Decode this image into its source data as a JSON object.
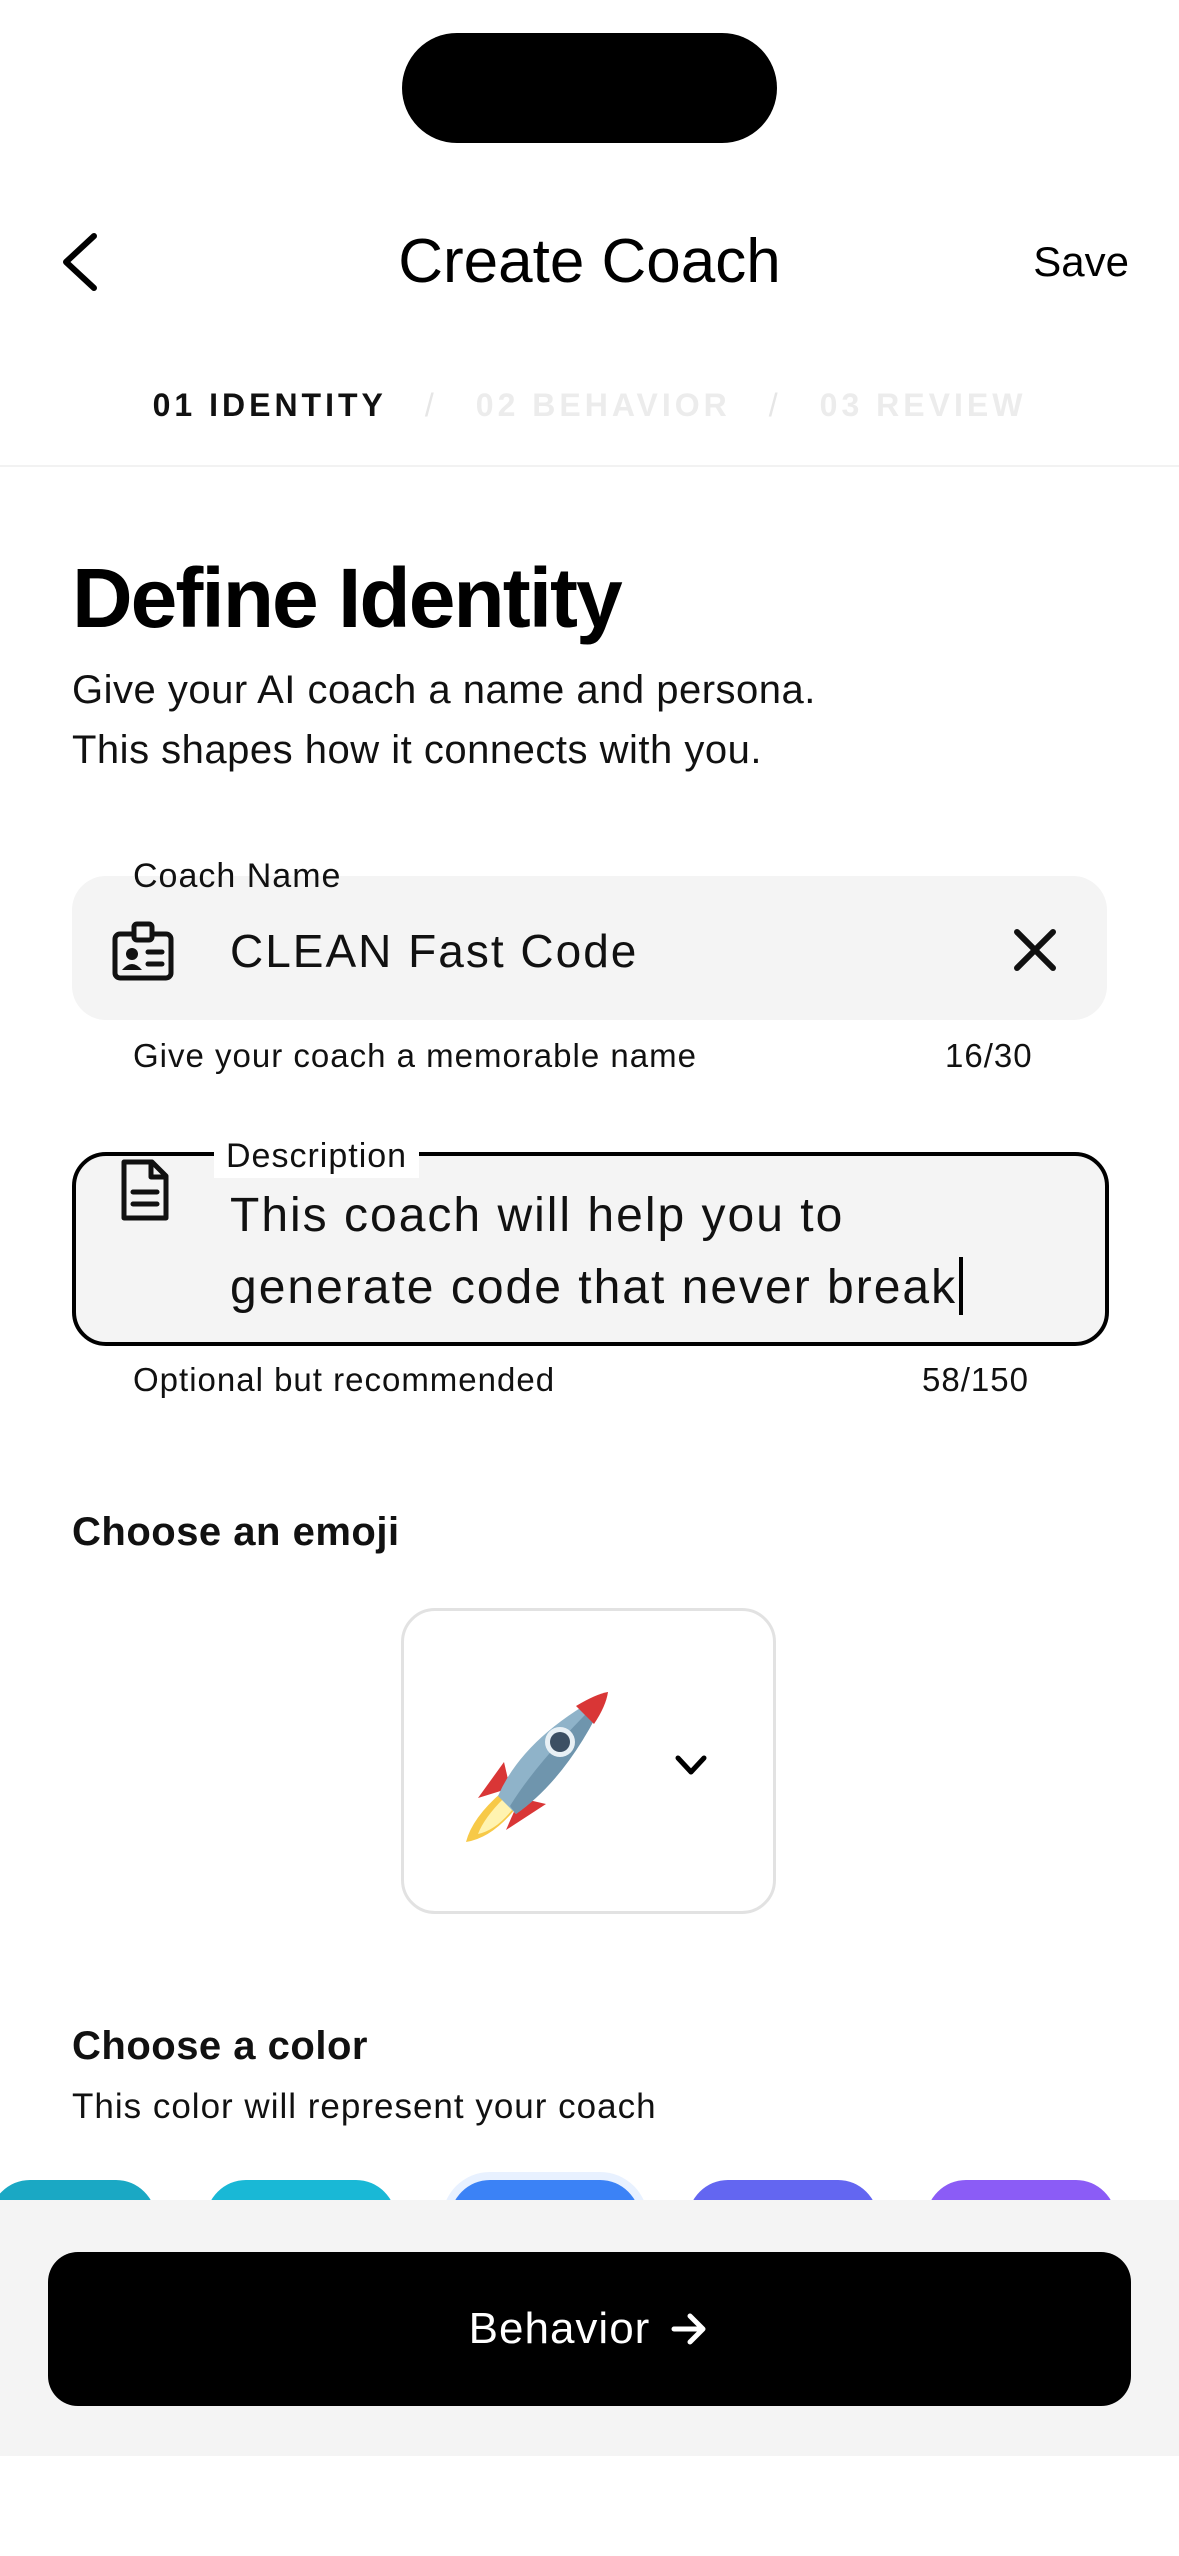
{
  "header": {
    "title": "Create Coach",
    "save_label": "Save"
  },
  "steps": [
    {
      "label": "01 IDENTITY",
      "state": "active"
    },
    {
      "label": "02 BEHAVIOR",
      "state": "inactive"
    },
    {
      "label": "03 REVIEW",
      "state": "inactive"
    }
  ],
  "step_separator": "/",
  "identity": {
    "heading": "Define Identity",
    "subtitle_line1": "Give your AI coach a name and persona.",
    "subtitle_line2": "This shapes how it connects with you."
  },
  "name_field": {
    "label": "Coach Name",
    "value": "CLEAN Fast Code",
    "helper": "Give your coach a memorable name",
    "count": "16/30",
    "icon": "id-badge-icon"
  },
  "description_field": {
    "label": "Description",
    "value_line1": "This coach will help you to",
    "value_line2": "generate code that never break",
    "helper": "Optional but recommended",
    "count": "58/150",
    "icon": "document-icon"
  },
  "emoji": {
    "heading": "Choose an emoji",
    "selected": "rocket"
  },
  "color": {
    "heading": "Choose a color",
    "subtitle": "This color will represent your coach",
    "swatches": [
      "#1aa8c4",
      "#19b8d6",
      "#3b82f6",
      "#6366f1",
      "#8b5cf6"
    ]
  },
  "cta": {
    "label": "Behavior"
  }
}
